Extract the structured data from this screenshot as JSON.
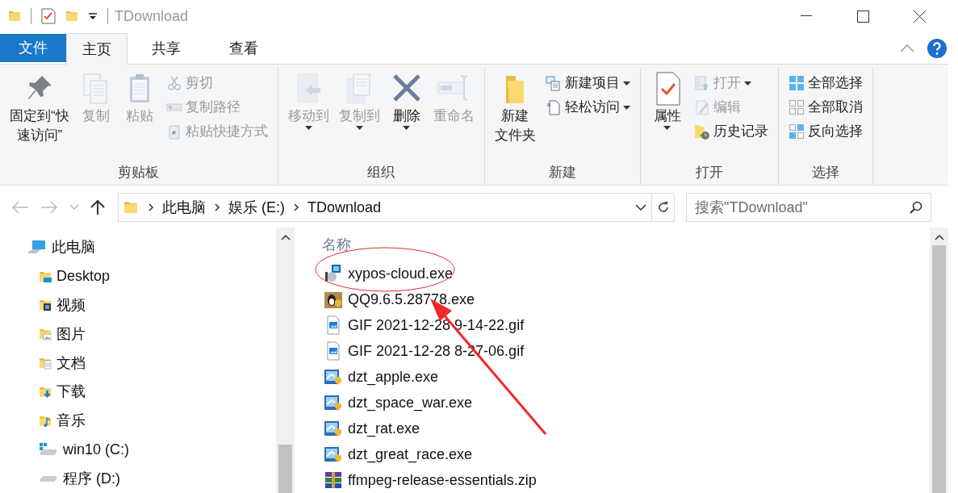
{
  "window": {
    "title": "TDownload"
  },
  "file_menu": {
    "label": "文件"
  },
  "ribbon_tabs": [
    {
      "label": "主页",
      "selected": true
    },
    {
      "label": "共享",
      "selected": false
    },
    {
      "label": "查看",
      "selected": false
    }
  ],
  "ribbon_groups": [
    {
      "label": "剪贴板",
      "items": [
        {
          "kind": "large",
          "lines": [
            "固定到“快",
            "速访问”"
          ],
          "disabled": false,
          "menu": false
        },
        {
          "kind": "large",
          "lines": [
            "复制"
          ],
          "disabled": true,
          "menu": false
        },
        {
          "kind": "large",
          "lines": [
            "粘贴"
          ],
          "disabled": true,
          "menu": false
        },
        {
          "kind": "small",
          "label": "剪切",
          "disabled": true,
          "menu": false
        },
        {
          "kind": "small",
          "label": "复制路径",
          "disabled": true,
          "menu": false
        },
        {
          "kind": "small",
          "label": "粘贴快捷方式",
          "disabled": true,
          "menu": false
        }
      ]
    },
    {
      "label": "组织",
      "items": [
        {
          "kind": "large",
          "lines": [
            "移动到"
          ],
          "disabled": true,
          "menu": true
        },
        {
          "kind": "large",
          "lines": [
            "复制到"
          ],
          "disabled": true,
          "menu": true
        },
        {
          "kind": "large",
          "lines": [
            "删除"
          ],
          "disabled": false,
          "menu": true
        },
        {
          "kind": "large",
          "lines": [
            "重命名"
          ],
          "disabled": true,
          "menu": false
        }
      ]
    },
    {
      "label": "新建",
      "items": [
        {
          "kind": "large",
          "lines": [
            "新建",
            "文件夹"
          ],
          "disabled": false,
          "menu": false
        },
        {
          "kind": "small",
          "label": "新建项目",
          "disabled": false,
          "menu": true
        },
        {
          "kind": "small",
          "label": "轻松访问",
          "disabled": false,
          "menu": true
        }
      ]
    },
    {
      "label": "打开",
      "items": [
        {
          "kind": "large",
          "lines": [
            "属性"
          ],
          "disabled": false,
          "menu": true
        },
        {
          "kind": "small",
          "label": "打开",
          "disabled": true,
          "menu": true
        },
        {
          "kind": "small",
          "label": "编辑",
          "disabled": true,
          "menu": false
        },
        {
          "kind": "small",
          "label": "历史记录",
          "disabled": false,
          "menu": false
        }
      ]
    },
    {
      "label": "选择",
      "items": [
        {
          "kind": "small",
          "label": "全部选择",
          "disabled": false,
          "menu": false
        },
        {
          "kind": "small",
          "label": "全部取消",
          "disabled": false,
          "menu": false
        },
        {
          "kind": "small",
          "label": "反向选择",
          "disabled": false,
          "menu": false
        }
      ]
    }
  ],
  "address_bar": {
    "path": [
      "此电脑",
      "娱乐 (E:)",
      "TDownload"
    ]
  },
  "search": {
    "placeholder": "搜索\"TDownload\""
  },
  "navigation_pane": {
    "items": [
      {
        "label": "此电脑",
        "kind": "pc",
        "children": [
          {
            "label": "Desktop",
            "kind": "desktop"
          },
          {
            "label": "视频",
            "kind": "videos"
          },
          {
            "label": "图片",
            "kind": "pictures"
          },
          {
            "label": "文档",
            "kind": "documents"
          },
          {
            "label": "下载",
            "kind": "downloads"
          },
          {
            "label": "音乐",
            "kind": "music"
          },
          {
            "label": "win10 (C:)",
            "kind": "system-drive"
          },
          {
            "label": "程序 (D:)",
            "kind": "drive"
          }
        ]
      }
    ]
  },
  "file_list": {
    "columns": [
      "名称"
    ],
    "files": [
      {
        "name": "xypos-cloud.exe",
        "kind": "installer"
      },
      {
        "name": "QQ9.6.5.28778.exe",
        "kind": "qq"
      },
      {
        "name": "GIF 2021-12-28 9-14-22.gif",
        "kind": "image"
      },
      {
        "name": "GIF 2021-12-28 8-27-06.gif",
        "kind": "image"
      },
      {
        "name": "dzt_apple.exe",
        "kind": "app"
      },
      {
        "name": "dzt_space_war.exe",
        "kind": "app"
      },
      {
        "name": "dzt_rat.exe",
        "kind": "app"
      },
      {
        "name": "dzt_great_race.exe",
        "kind": "app"
      },
      {
        "name": "ffmpeg-release-essentials.zip",
        "kind": "archive"
      }
    ]
  }
}
